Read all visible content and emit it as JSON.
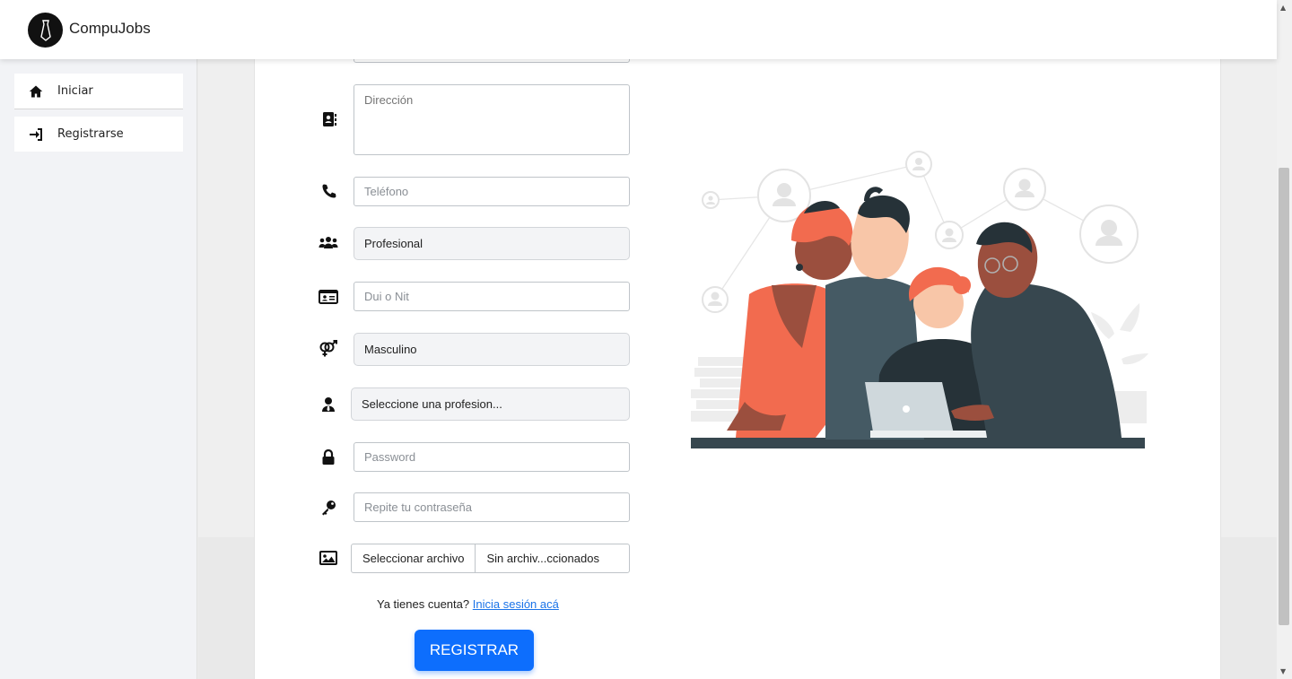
{
  "header": {
    "brand": "CompuJobs"
  },
  "sidebar": {
    "items": [
      {
        "label": "Iniciar",
        "icon": "home-icon"
      },
      {
        "label": "Registrarse",
        "icon": "sign-in-icon"
      }
    ]
  },
  "form": {
    "address_placeholder": "Dirección",
    "phone_placeholder": "Teléfono",
    "user_type_value": "Profesional",
    "dui_placeholder": "Dui o Nit",
    "gender_value": "Masculino",
    "profession_value": "Seleccione una profesion...",
    "password_placeholder": "Password",
    "repeat_password_placeholder": "Repite tu contraseña",
    "file_button": "Seleccionar archivo",
    "file_name": "Sin archiv...ccionados",
    "login_prompt": "Ya tienes cuenta?",
    "login_link": "Inicia sesión acá",
    "register_button": "REGISTRAR"
  },
  "colors": {
    "primary": "#0d6efd",
    "link": "#1a73e8",
    "illustration_orange": "#f26b4f",
    "illustration_teal": "#37474f"
  }
}
